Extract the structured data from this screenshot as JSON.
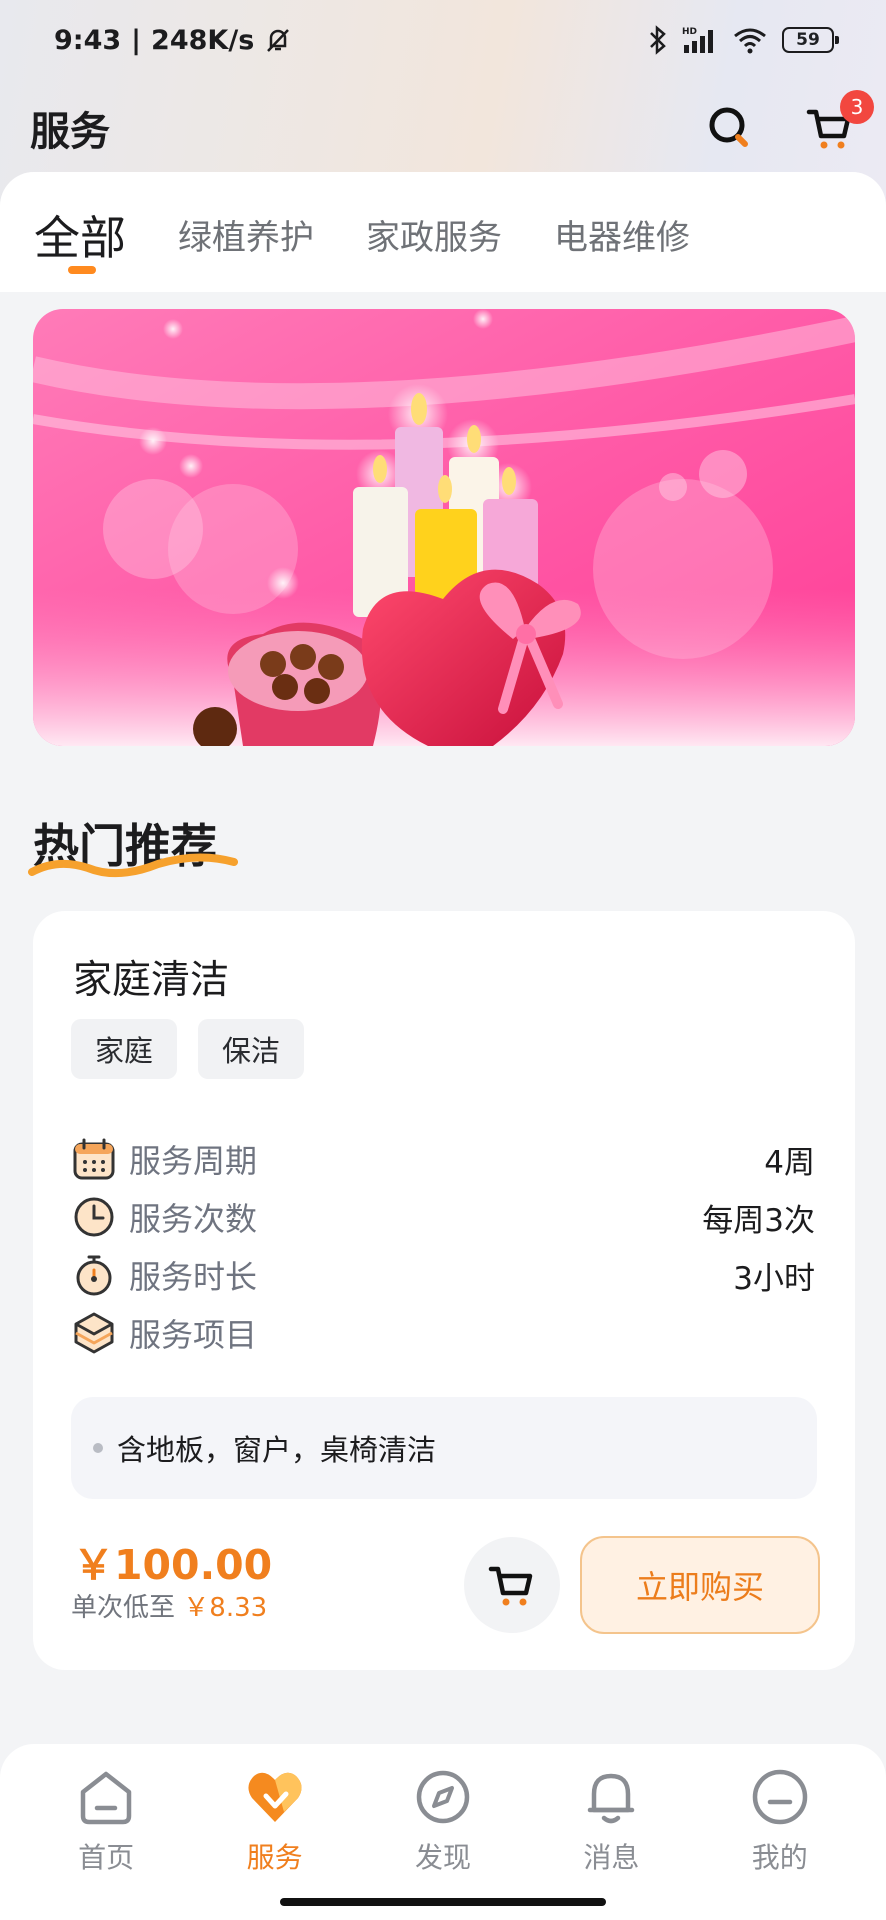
{
  "status_bar": {
    "time": "9:43",
    "network_speed": "248K/s",
    "battery": "59",
    "icons": [
      "mute-bell-icon",
      "bluetooth-icon",
      "hd-signal-icon",
      "wifi-icon",
      "battery-icon"
    ]
  },
  "header": {
    "title": "服务",
    "cart_badge": "3",
    "icons": [
      "search-icon",
      "cart-icon"
    ]
  },
  "tabs": [
    {
      "label": "全部",
      "active": true
    },
    {
      "label": "绿植养护",
      "active": false
    },
    {
      "label": "家政服务",
      "active": false
    },
    {
      "label": "电器维修",
      "active": false
    }
  ],
  "banner": {
    "subject": "candles-heart-chocolates"
  },
  "section": {
    "title": "热门推荐"
  },
  "product": {
    "title": "家庭清洁",
    "tags": [
      "家庭",
      "保洁"
    ],
    "specs": [
      {
        "icon": "calendar-icon",
        "label": "服务周期",
        "value": "4周"
      },
      {
        "icon": "clock-icon",
        "label": "服务次数",
        "value": "每周3次"
      },
      {
        "icon": "stopwatch-icon",
        "label": "服务时长",
        "value": "3小时"
      },
      {
        "icon": "box-layers-icon",
        "label": "服务项目",
        "value": ""
      }
    ],
    "description": "含地板，窗户，桌椅清洁",
    "price": "￥100.00",
    "unit_price_label": "单次低至",
    "unit_price_value": "￥8.33",
    "buy_label": "立即购买"
  },
  "bottom_nav": [
    {
      "label": "首页",
      "icon": "home-icon",
      "active": false
    },
    {
      "label": "服务",
      "icon": "service-heart-icon",
      "active": true
    },
    {
      "label": "发现",
      "icon": "compass-icon",
      "active": false
    },
    {
      "label": "消息",
      "icon": "bell-icon",
      "active": false
    },
    {
      "label": "我的",
      "icon": "profile-icon",
      "active": false
    }
  ],
  "colors": {
    "accent": "#f07f1e",
    "badge": "#f2473f",
    "banner_pink": "#ff6fb0"
  }
}
